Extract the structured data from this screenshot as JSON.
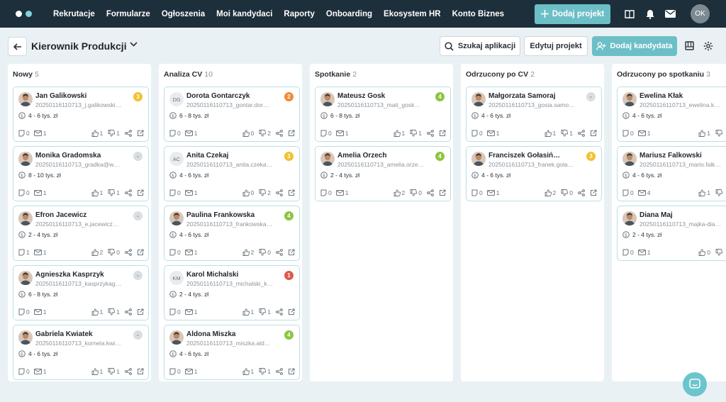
{
  "nav": [
    "Rekrutacje",
    "Formularze",
    "Ogłoszenia",
    "Moi kandydaci",
    "Raporty",
    "Onboarding",
    "Ekosystem HR",
    "Konto Biznes"
  ],
  "header": {
    "add_project": "Dodaj projekt",
    "avatar": "OK"
  },
  "subbar": {
    "title": "Kierownik Produkcji",
    "search": "Szukaj aplikacji",
    "edit": "Edytuj projekt",
    "add_candidate": "Dodaj kandydata"
  },
  "colors": {
    "teal": "#6cbfc7",
    "dark": "#1d2f3a",
    "yellow": "#f2c12e",
    "orange": "#ef8a3b",
    "green": "#8cc63f",
    "red": "#e05a4f",
    "gray": "#d9dee2"
  },
  "columns": [
    {
      "name": "Nowy",
      "count": "5",
      "cards": [
        {
          "name": "Jan Galikowski",
          "email": "20250116110713_j.galikowski…",
          "salary": "4 - 6 tys. zł",
          "badge": "3",
          "badge_color": "#f2c12e",
          "avatar": "photo",
          "notes": "0",
          "mails": "1",
          "up": "1",
          "down": "1"
        },
        {
          "name": "Monika Gradomska",
          "email": "20250116110713_gradka@w…",
          "salary": "8 - 10 tys. zł",
          "badge": "-",
          "badge_color": "#d9dee2",
          "avatar": "photo",
          "notes": "0",
          "mails": "1",
          "up": "1",
          "down": "1"
        },
        {
          "name": "Efron Jacewicz",
          "email": "20250116110713_e.jacewicz…",
          "salary": "2 - 4 tys. zł",
          "badge": "-",
          "badge_color": "#d9dee2",
          "avatar": "photo",
          "notes": "1",
          "mails": "1",
          "up": "2",
          "down": "0"
        },
        {
          "name": "Agnieszka Kasprzyk",
          "email": "20250116110713_kasprzykag…",
          "salary": "6 - 8 tys. zł",
          "badge": "-",
          "badge_color": "#d9dee2",
          "avatar": "photo",
          "notes": "0",
          "mails": "1",
          "up": "1",
          "down": "1"
        },
        {
          "name": "Gabriela Kwiatek",
          "email": "20250116110713_kornela.kwi…",
          "salary": "4 - 6 tys. zł",
          "badge": "-",
          "badge_color": "#d9dee2",
          "avatar": "photo",
          "notes": "0",
          "mails": "1",
          "up": "1",
          "down": "1"
        }
      ]
    },
    {
      "name": "Analiza CV",
      "count": "10",
      "cards": [
        {
          "name": "Dorota Gontarczyk",
          "email": "20250116110713_gontar.dor…",
          "salary": "6 - 8 tys. zł",
          "badge": "2",
          "badge_color": "#ef8a3b",
          "avatar": "DG",
          "notes": "0",
          "mails": "1",
          "up": "0",
          "down": "2"
        },
        {
          "name": "Anita Czekaj",
          "email": "20250116110713_anita.czeka…",
          "salary": "4 - 6 tys. zł",
          "badge": "3",
          "badge_color": "#f2c12e",
          "avatar": "AC",
          "notes": "0",
          "mails": "1",
          "up": "0",
          "down": "2"
        },
        {
          "name": "Paulina Frankowska",
          "email": "20250116110713_frankowska…",
          "salary": "4 - 6 tys. zł",
          "badge": "4",
          "badge_color": "#8cc63f",
          "avatar": "photo",
          "notes": "0",
          "mails": "1",
          "up": "2",
          "down": "0"
        },
        {
          "name": "Karol Michalski",
          "email": "20250116110713_michalski_k…",
          "salary": "2 - 4 tys. zł",
          "badge": "1",
          "badge_color": "#e05a4f",
          "avatar": "KM",
          "notes": "0",
          "mails": "1",
          "up": "1",
          "down": "1"
        },
        {
          "name": "Aldona Miszka",
          "email": "20250116110713_miszka.ald…",
          "salary": "4 - 6 tys. zł",
          "badge": "4",
          "badge_color": "#8cc63f",
          "avatar": "photo",
          "notes": "0",
          "mails": "1",
          "up": "1",
          "down": "1"
        }
      ]
    },
    {
      "name": "Spotkanie",
      "count": "2",
      "cards": [
        {
          "name": "Mateusz Gosk",
          "email": "20250116110713_mati_gosk…",
          "salary": "6 - 8 tys. zł",
          "badge": "4",
          "badge_color": "#8cc63f",
          "avatar": "photo",
          "notes": "0",
          "mails": "1",
          "up": "1",
          "down": "1"
        },
        {
          "name": "Amelia Orzech",
          "email": "20250116110713_amelia.orze…",
          "salary": "2 - 4 tys. zł",
          "badge": "4",
          "badge_color": "#8cc63f",
          "avatar": "photo",
          "notes": "0",
          "mails": "1",
          "up": "2",
          "down": "0"
        }
      ]
    },
    {
      "name": "Odrzucony po CV",
      "count": "2",
      "cards": [
        {
          "name": "Małgorzata Samoraj",
          "email": "20250116110713_gosia.samo…",
          "salary": "4 - 6 tys. zł",
          "badge": "-",
          "badge_color": "#d9dee2",
          "avatar": "photo",
          "notes": "0",
          "mails": "1",
          "up": "1",
          "down": "1"
        },
        {
          "name": "Franciszek Gołasiń…",
          "email": "20250116110713_franek.gola…",
          "salary": "4 - 6 tys. zł",
          "badge": "3",
          "badge_color": "#f2c12e",
          "avatar": "photo",
          "notes": "0",
          "mails": "1",
          "up": "2",
          "down": "0"
        }
      ]
    },
    {
      "name": "Odrzucony po spotkaniu",
      "count": "3",
      "cards": [
        {
          "name": "Ewelina Kłak",
          "email": "20250116110713_ewelina.k…",
          "salary": "4 - 6 tys. zł",
          "badge": "",
          "badge_color": "",
          "avatar": "photo",
          "notes": "0",
          "mails": "1",
          "up": "1",
          "down": ""
        },
        {
          "name": "Mariusz Falkowski",
          "email": "20250116110713_mario.falk…",
          "salary": "4 - 6 tys. zł",
          "badge": "",
          "badge_color": "",
          "avatar": "photo",
          "notes": "0",
          "mails": "4",
          "up": "1",
          "down": ""
        },
        {
          "name": "Diana Maj",
          "email": "20250116110713_majka-dia…",
          "salary": "2 - 4 tys. zł",
          "badge": "",
          "badge_color": "",
          "avatar": "photo",
          "notes": "0",
          "mails": "1",
          "up": "0",
          "down": ""
        }
      ]
    }
  ]
}
